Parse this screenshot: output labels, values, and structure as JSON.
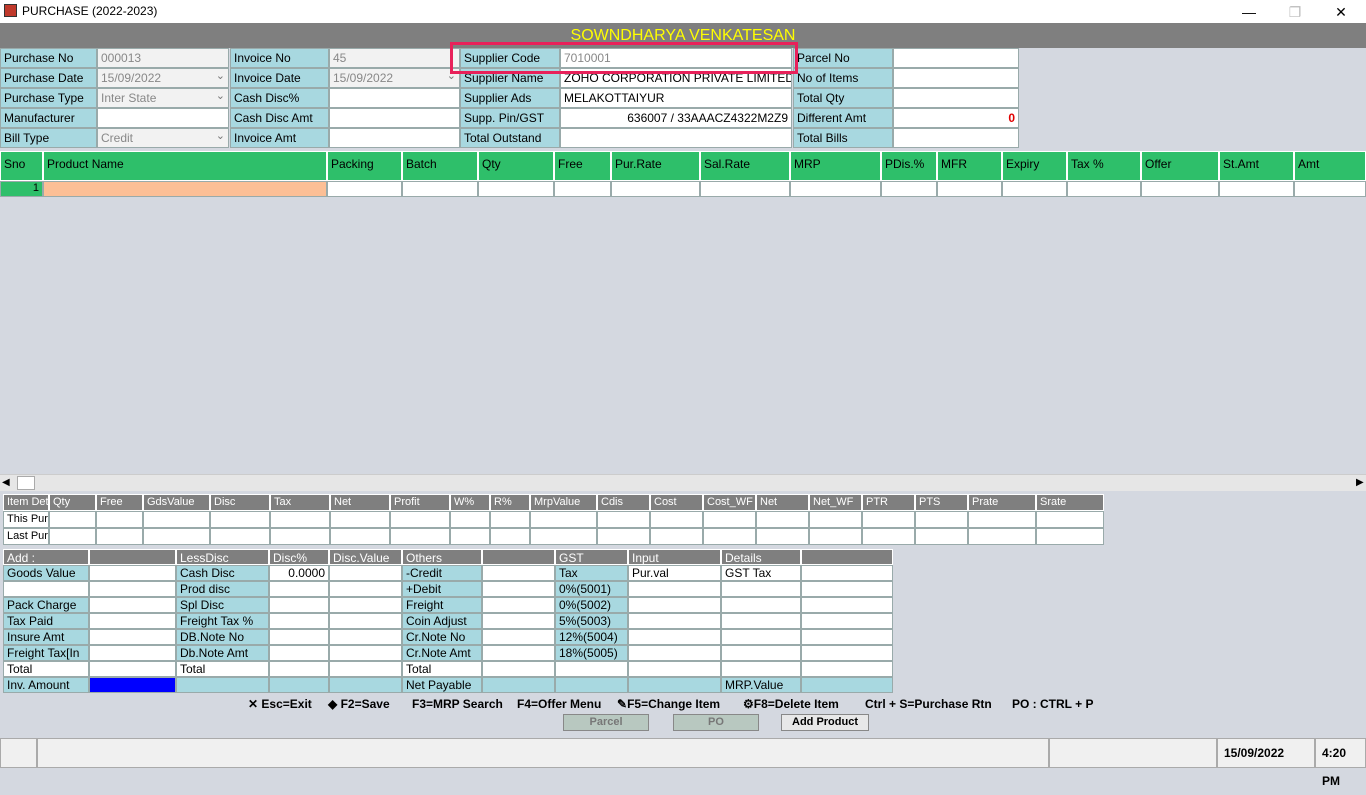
{
  "window": {
    "title": "PURCHASE (2022-2023)",
    "minimize": "—",
    "restore": "❐",
    "close": "✕"
  },
  "banner": "SOWNDHARYA VENKATESAN",
  "form": {
    "purchase_no_label": "Purchase No",
    "purchase_no": "000013",
    "purchase_date_label": "Purchase Date",
    "purchase_date": "15/09/2022",
    "purchase_type_label": "Purchase Type",
    "purchase_type": "Inter State",
    "manufacturer_label": "Manufacturer",
    "manufacturer": "",
    "bill_type_label": "Bill Type",
    "bill_type": "Credit",
    "invoice_no_label": "Invoice No",
    "invoice_no": "45",
    "invoice_date_label": "Invoice Date",
    "invoice_date": "15/09/2022",
    "cash_disc_pct_label": "Cash Disc%",
    "cash_disc_pct": "",
    "cash_disc_amt_label": "Cash Disc Amt",
    "cash_disc_amt": "",
    "invoice_amt_label": "Invoice Amt",
    "invoice_amt": "",
    "supplier_code_label": "Supplier Code",
    "supplier_code": "7010001",
    "supplier_name_label": "Supplier Name",
    "supplier_name": "ZOHO CORPORATION PRIVATE LIMITED",
    "supplier_ads_label": "Supplier Ads",
    "supplier_ads": "MELAKOTTAIYUR",
    "supp_pin_label": "Supp. Pin/GST",
    "supp_pin": "636007 / 33AAACZ4322M2Z9",
    "total_outstand_label": "Total Outstand",
    "total_outstand": "",
    "parcel_no_label": "Parcel No",
    "no_of_items_label": "No of Items",
    "total_qty_label": "Total Qty",
    "different_amt_label": "Different Amt",
    "different_amt": "0",
    "total_bills_label": "Total Bills"
  },
  "grid": {
    "columns": [
      "Sno",
      "Product Name",
      "Packing",
      "Batch",
      "Qty",
      "Free",
      "Pur.Rate",
      "Sal.Rate",
      "MRP",
      "PDis.%",
      "MFR",
      "Expiry",
      "Tax %",
      "Offer",
      "St.Amt",
      "Amt"
    ],
    "first_row_sno": "1"
  },
  "item_details": {
    "columns": [
      "Item Deta",
      "Qty",
      "Free",
      "GdsValue",
      "Disc",
      "Tax",
      "Net",
      "Profit",
      "W%",
      "R%",
      "MrpValue",
      "Cdis",
      "Cost",
      "Cost_WF",
      "Net",
      "Net_WF",
      "PTR",
      "PTS",
      "Prate",
      "Srate"
    ],
    "rows": [
      "This Purc",
      "Last Pur"
    ]
  },
  "totals": {
    "add_header": "Add :",
    "less_header": "LessDisc",
    "disc_pct_header": "Disc%",
    "disc_value_header": "Disc.Value",
    "others_header": "Others",
    "gst_header": "GST",
    "input_header": "Input",
    "details_header": "Details",
    "add_rows": [
      "Goods Value",
      "",
      "Pack Charge",
      "Tax Paid",
      "Insure Amt",
      "Freight Tax[In",
      "Total",
      "Inv. Amount"
    ],
    "less_rows": [
      "Cash Disc",
      "Prod disc",
      "Spl Disc",
      "Freight Tax %",
      "DB.Note No",
      "Db.Note Amt",
      "Total",
      ""
    ],
    "cash_disc_value": "0.0000",
    "others_rows": [
      "-Credit",
      "+Debit",
      "Freight",
      "Coin Adjust",
      "Cr.Note No",
      "Cr.Note Amt",
      "Total",
      "Net Payable"
    ],
    "gst_rows": [
      "Tax",
      "0%(5001)",
      "0%(5002)",
      "5%(5003)",
      "12%(5004)",
      "18%(5005)",
      "",
      ""
    ],
    "input_first": "Pur.val",
    "details_first": "GST Tax",
    "details_last": "MRP.Value"
  },
  "shortcuts": {
    "esc": "Esc=Exit",
    "f2": "F2=Save",
    "f3": "F3=MRP Search",
    "f4": "F4=Offer Menu",
    "f5": "F5=Change Item",
    "f8": "F8=Delete Item",
    "ctrl_s": "Ctrl + S=Purchase Rtn",
    "po": "PO : CTRL + P"
  },
  "buttons": {
    "parcel": "Parcel",
    "po": "PO",
    "add_product": "Add Product"
  },
  "statusbar": {
    "date": "15/09/2022",
    "time": "4:20 PM"
  }
}
